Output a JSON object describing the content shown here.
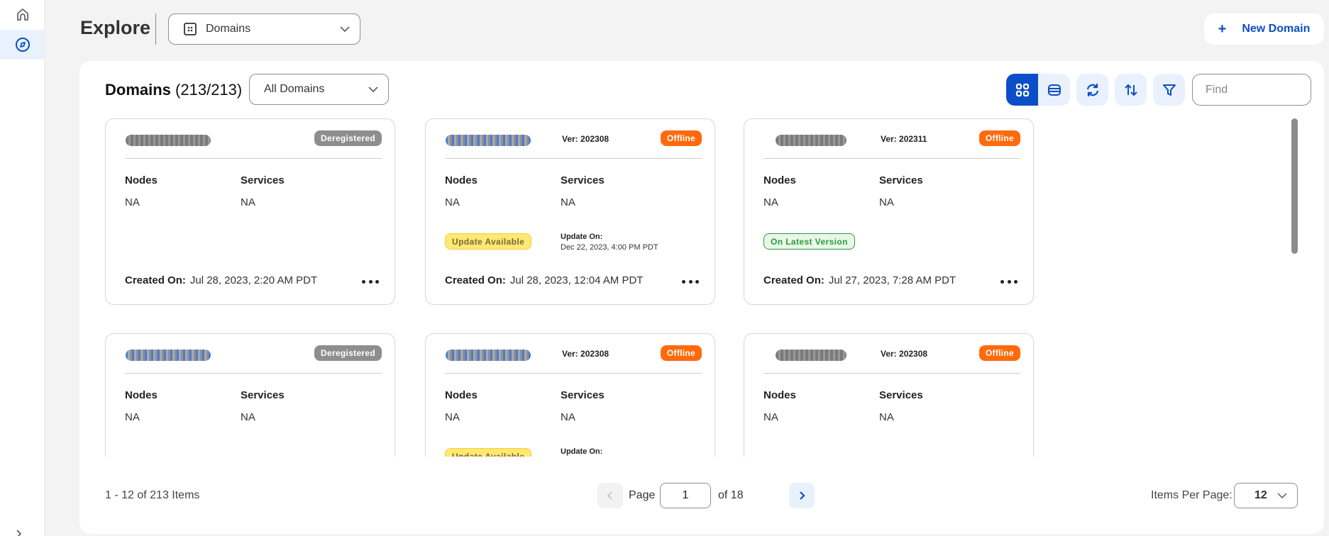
{
  "sidebar": {
    "items": [
      {
        "name": "home",
        "icon": "home-icon",
        "active": false
      },
      {
        "name": "explore",
        "icon": "compass-icon",
        "active": true
      }
    ],
    "expand_icon": "chevron-right-icon"
  },
  "header": {
    "title": "Explore",
    "type_select": {
      "value": "Domains",
      "icon": "domain-grid-icon"
    },
    "new_button": {
      "label": "New Domain",
      "icon": "plus-icon"
    }
  },
  "panel": {
    "title": "Domains",
    "count": "(213/213)",
    "scope_select": {
      "value": "All Domains"
    },
    "toolbar": {
      "view_grid": {
        "icon": "grid-view-icon",
        "active": true
      },
      "view_list": {
        "icon": "list-view-icon",
        "active": false
      },
      "refresh": {
        "icon": "refresh-icon"
      },
      "sort": {
        "icon": "sort-icon"
      },
      "filter": {
        "icon": "filter-icon"
      },
      "find_placeholder": "Find"
    },
    "labels": {
      "nodes": "Nodes",
      "services": "Services",
      "created_on": "Created On:",
      "update_on": "Update On:"
    },
    "cards": [
      {
        "name": "[redacted]",
        "name_style": "gray",
        "version": "",
        "status": "Deregistered",
        "status_type": "dereg",
        "nodes": "NA",
        "services": "NA",
        "update_pill": "",
        "update_pill_type": "",
        "update_on": "",
        "created_on": "Jul 28, 2023, 2:20 AM PDT"
      },
      {
        "name": "[redacted]",
        "name_style": "link",
        "version": "Ver: 202308",
        "status": "Offline",
        "status_type": "offline",
        "nodes": "NA",
        "services": "NA",
        "update_pill": "Update Available",
        "update_pill_type": "update",
        "update_on": "Dec 22, 2023, 4:00 PM PDT",
        "created_on": "Jul 28, 2023, 12:04 AM PDT"
      },
      {
        "name": "[redacted]",
        "name_style": "gray",
        "version": "Ver: 202311",
        "status": "Offline",
        "status_type": "offline",
        "nodes": "NA",
        "services": "NA",
        "update_pill": "On Latest Version",
        "update_pill_type": "latest",
        "update_on": "",
        "created_on": "Jul 27, 2023, 7:28 AM PDT"
      },
      {
        "name": "[redacted]",
        "name_style": "link",
        "version": "",
        "status": "Deregistered",
        "status_type": "dereg",
        "nodes": "NA",
        "services": "NA",
        "update_pill": "",
        "update_pill_type": "",
        "update_on": "",
        "created_on": ""
      },
      {
        "name": "[redacted]",
        "name_style": "link",
        "version": "Ver: 202308",
        "status": "Offline",
        "status_type": "offline",
        "nodes": "NA",
        "services": "NA",
        "update_pill": "Update Available",
        "update_pill_type": "update",
        "update_on": "",
        "created_on": ""
      },
      {
        "name": "[redacted]",
        "name_style": "gray",
        "version": "Ver: 202308",
        "status": "Offline",
        "status_type": "offline",
        "nodes": "NA",
        "services": "NA",
        "update_pill": "",
        "update_pill_type": "",
        "update_on": "",
        "created_on": ""
      }
    ]
  },
  "footer": {
    "items_count": "1 - 12 of 213 Items",
    "page_label": "Page",
    "page_value": "1",
    "of_label": "of  18",
    "items_per_page_label": "Items Per Page:",
    "items_per_page_value": "12"
  },
  "colors": {
    "accent": "#0c4ec7",
    "offline": "#ff6a0d",
    "deregistered": "#8e8e8e",
    "update_available": "#ffe873",
    "latest": "#2c9a3c"
  }
}
